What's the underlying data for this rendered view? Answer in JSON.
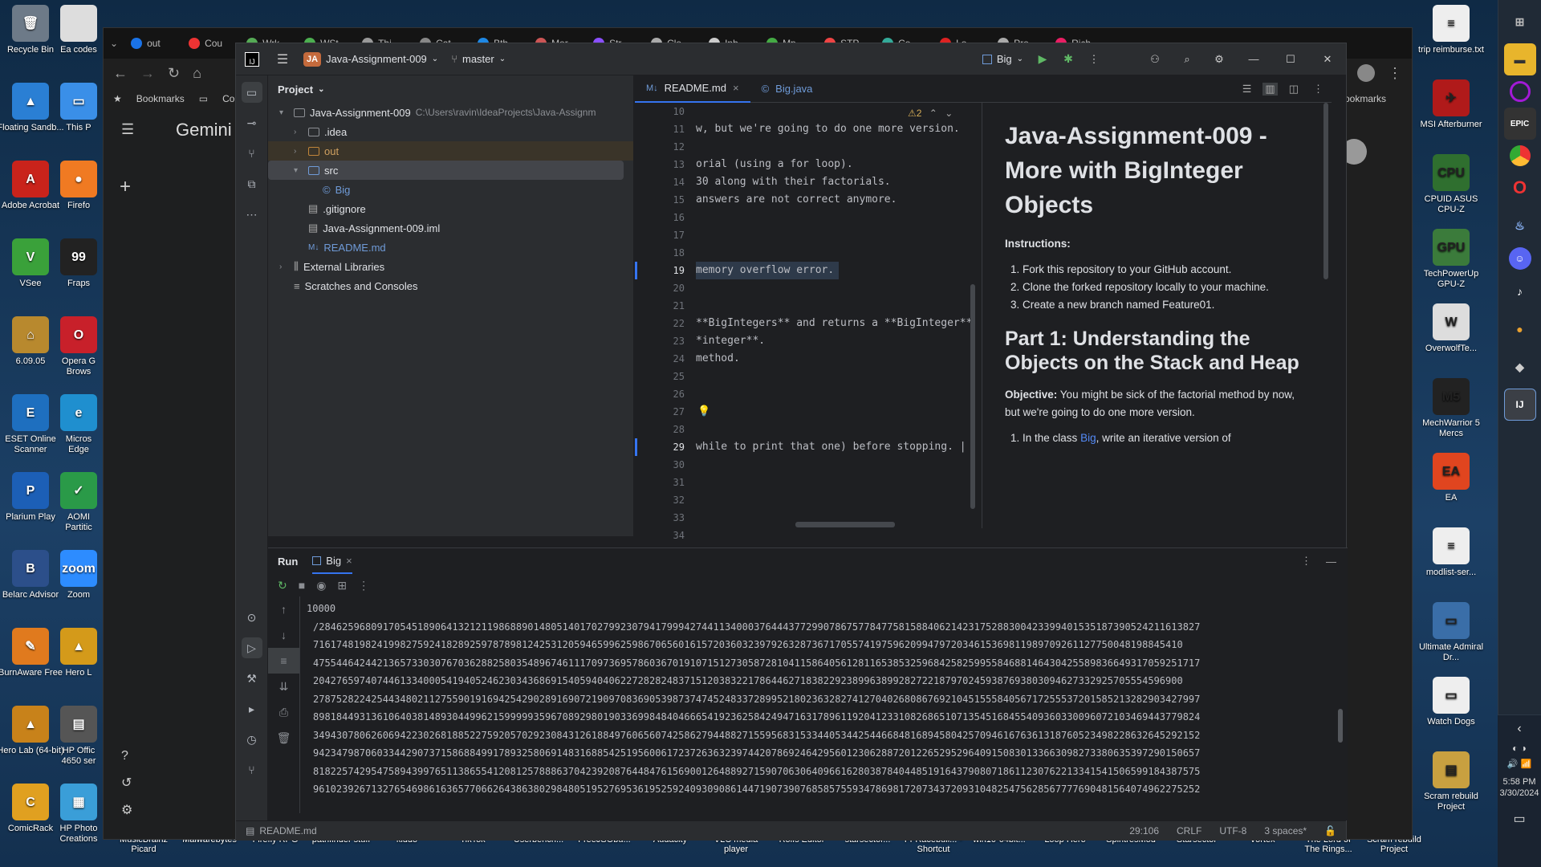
{
  "desktop": {
    "left_icons": [
      {
        "label": "Recycle Bin",
        "color": "#6d7a88",
        "glyph": "🗑"
      },
      {
        "label": "Ea codes",
        "color": "#ddd",
        "glyph": ""
      },
      {
        "label": "Floating Sandb...",
        "color": "#2a7fd4",
        "glyph": "▲"
      },
      {
        "label": "This P",
        "color": "#3a8fe8",
        "glyph": "▭"
      },
      {
        "label": "Adobe Acrobat",
        "color": "#c9231b",
        "glyph": "A"
      },
      {
        "label": "Firefo",
        "color": "#f07a22",
        "glyph": "●"
      },
      {
        "label": "VSee",
        "color": "#3aa13a",
        "glyph": "V"
      },
      {
        "label": "Fraps",
        "color": "#222",
        "glyph": "99"
      },
      {
        "label": "6.09.05",
        "color": "#b8892e",
        "glyph": "⌂"
      },
      {
        "label": "Opera G Brows",
        "color": "#c8202a",
        "glyph": "O"
      },
      {
        "label": "ESET Online Scanner",
        "color": "#1e6fbf",
        "glyph": "E"
      },
      {
        "label": "Micros Edge",
        "color": "#1f8fcf",
        "glyph": "e"
      },
      {
        "label": "Plarium Play",
        "color": "#1c5fb6",
        "glyph": "P"
      },
      {
        "label": "AOMI Partitic",
        "color": "#2a9a48",
        "glyph": "✓"
      },
      {
        "label": "Belarc Advisor",
        "color": "#2c4f8a",
        "glyph": "B"
      },
      {
        "label": "Zoom",
        "color": "#2d8cff",
        "glyph": "zoom"
      },
      {
        "label": "BurnAware Free",
        "color": "#e07a1e",
        "glyph": "✎"
      },
      {
        "label": "Hero L",
        "color": "#d49a1a",
        "glyph": "▲"
      },
      {
        "label": "Hero Lab (64-bit)",
        "color": "#c8821a",
        "glyph": "▲"
      },
      {
        "label": "HP Offic 4650 ser",
        "color": "#555",
        "glyph": "▤"
      },
      {
        "label": "ComicRack",
        "color": "#e0a020",
        "glyph": "C"
      },
      {
        "label": "HP Photo Creations",
        "color": "#3a9ed8",
        "glyph": "▦"
      }
    ],
    "bottom_labels": [
      "MusicBrainz Picard",
      "Malwarebytes",
      "Firefly RPG",
      "pathfinder stuff",
      "kiddo",
      "TikTok",
      "Userbench...",
      "FreeJSObu...",
      "Audacity",
      "VLC media player",
      "Rolfs Editor",
      "starsector...",
      "FFRacebuil... - Shortcut",
      "win10-64bit...",
      "Loop Hero",
      "SpiritresMod",
      "Starsector",
      "Vortex",
      "The Lord of The Rings...",
      "Scram rebuild Project"
    ],
    "right_icons": [
      {
        "label": "trip reimburse.txt",
        "color": "#eee",
        "glyph": "≡"
      },
      {
        "label": "MSI Afterburner",
        "color": "#b01a1a",
        "glyph": "✈"
      },
      {
        "label": "CPUID ASUS CPU-Z",
        "color": "#2f6f2f",
        "glyph": "CPU"
      },
      {
        "label": "TechPowerUp GPU-Z",
        "color": "#3b7b3b",
        "glyph": "GPU"
      },
      {
        "label": "OverwolfTe...",
        "color": "#ddd",
        "glyph": "W"
      },
      {
        "label": "MechWarrior 5 Mercs",
        "color": "#222",
        "glyph": "M5"
      },
      {
        "label": "EA",
        "color": "#e0451f",
        "glyph": "EA"
      },
      {
        "label": "modlist-ser...",
        "color": "#eee",
        "glyph": "≡"
      },
      {
        "label": "Ultimate Admiral Dr...",
        "color": "#3a6ea8",
        "glyph": "▭"
      },
      {
        "label": "Watch Dogs",
        "color": "#eee",
        "glyph": "▭"
      },
      {
        "label": "Scram rebuild Project",
        "color": "#c8a040",
        "glyph": "▤"
      }
    ],
    "tray_time": "5:58 PM",
    "tray_date": "3/30/2024"
  },
  "browser": {
    "tabs": [
      "out",
      "Cou",
      "Wrk",
      "WSt",
      "Thi",
      "Cat",
      "Bth",
      "Mor",
      "Str",
      "Clo",
      "Inb",
      "Mp",
      "STP",
      "Co",
      "Lo",
      "Pro",
      "Rich"
    ],
    "bookmarks_label": "Bookmarks",
    "comics_label": "Comi",
    "all_bookmarks": "All Bookmarks",
    "gemini_title": "Gemini"
  },
  "ide": {
    "project_badge": "JA",
    "project_name": "Java-Assignment-009",
    "branch": "master",
    "run_config": "Big",
    "project_panel_title": "Project",
    "tree": [
      {
        "label": "Java-Assignment-009",
        "path": "C:\\Users\\ravin\\IdeaProjects\\Java-Assignm",
        "indent": 0,
        "arrow": "▾",
        "kind": "folder"
      },
      {
        "label": ".idea",
        "indent": 1,
        "arrow": "›",
        "kind": "folder"
      },
      {
        "label": "out",
        "indent": 1,
        "arrow": "›",
        "kind": "folder-orange"
      },
      {
        "label": "src",
        "indent": 1,
        "arrow": "▾",
        "kind": "folder-blue"
      },
      {
        "label": "Big",
        "indent": 2,
        "arrow": "",
        "kind": "class"
      },
      {
        "label": ".gitignore",
        "indent": 1,
        "arrow": "",
        "kind": "file"
      },
      {
        "label": "Java-Assignment-009.iml",
        "indent": 1,
        "arrow": "",
        "kind": "file"
      },
      {
        "label": "README.md",
        "indent": 1,
        "arrow": "",
        "kind": "md"
      },
      {
        "label": "External Libraries",
        "indent": 0,
        "arrow": "›",
        "kind": "lib"
      },
      {
        "label": "Scratches and Consoles",
        "indent": 0,
        "arrow": "",
        "kind": "scratch"
      }
    ],
    "editor_tabs": [
      {
        "label": "README.md",
        "prefix": "M↓"
      },
      {
        "label": "Big.java",
        "prefix": "©"
      }
    ],
    "warnings": "⚠2",
    "line_numbers": [
      "10",
      "11",
      "12",
      "13",
      "14",
      "15",
      "16",
      "17",
      "18",
      "19",
      "20",
      "21",
      "22",
      "23",
      "24",
      "25",
      "26",
      "27",
      "28",
      "29",
      "30",
      "31",
      "32",
      "33",
      "34"
    ],
    "code_lines": [
      "",
      "w, but we're going to do one more version.",
      "",
      "orial (using a for loop).",
      "30 along with their factorials.",
      "answers are not correct anymore.",
      "",
      "",
      "",
      "memory overflow error.",
      "",
      "",
      "**BigIntegers** and returns a **BigInteger**",
      "*integer**.",
      "method.",
      "",
      "",
      "",
      "",
      "while to print that one) before stopping. |",
      "",
      "",
      "",
      "",
      ""
    ],
    "preview": {
      "h1": "Java-Assignment-009 - More with BigInteger Objects",
      "instructions_label": "Instructions:",
      "steps": [
        "Fork this repository to your GitHub account.",
        "Clone the forked repository locally to your machine.",
        "Create a new branch named Feature01."
      ],
      "h2": "Part 1: Understanding the Objects on the Stack and Heap",
      "objective_label": "Objective:",
      "objective_text": "You might be sick of the factorial method by now, but we're going to do one more version.",
      "item1_prefix": "In the class",
      "item1_link": "Big",
      "item1_suffix": ", write an iterative version of"
    },
    "run": {
      "title": "Run",
      "tab": "Big",
      "output": [
        "10000",
        "/28462596809170545189064132121198688901480514017027992307941799942744113400037644437729907867577847758158840621423175288300423399401535187390524211613827",
        "716174819824199827592418289259787898124253120594659962598670656016157203603239792632873671705574197596209947972034615369811989709261127750048198845410",
        "475544642442136573303076703628825803548967461117097369578603670191071512730587281041158640561281165385325968425825995584688146430425589836649317059251717",
        "204276597407446133400054194052462303436869154059404062272828248371512038322178644627183822923899638992827221879702459387693803094627332925705554596900",
        "278752822425443480211275590191694254290289169072190970836905398737474524833728995218023632827412704026808676921045155584056717255537201585213282903427997",
        "898184493136106403814893044996215999993596708929801903369984840466654192362584249471631789611920412331082686510713545168455409360330096072103469443779824",
        "349430780626069422302681885227592057029230843126188497606560742586279448827155956831533440534425446684816894580425709461676361318760523498228632645292152",
        "942347987060334429073715868849917893258069148316885425195600617237263632397442078692464295601230628872012265295296409150830133663098273380635397290150657",
        "818225742954758943997651138655412081257888637042392087644847615690012648892715907063064096616280387840448519164379080718611230762213341541506599184387575",
        "961023926713276546986163657706626438638029848051952769536195259240930908614471907390768585755934786981720734372093104825475628567777690481564074962275252"
      ],
      "first_value": "10000"
    },
    "status": {
      "file": "README.md",
      "position": "29:106",
      "line_ending": "CRLF",
      "encoding": "UTF-8",
      "indent": "3 spaces*"
    }
  }
}
